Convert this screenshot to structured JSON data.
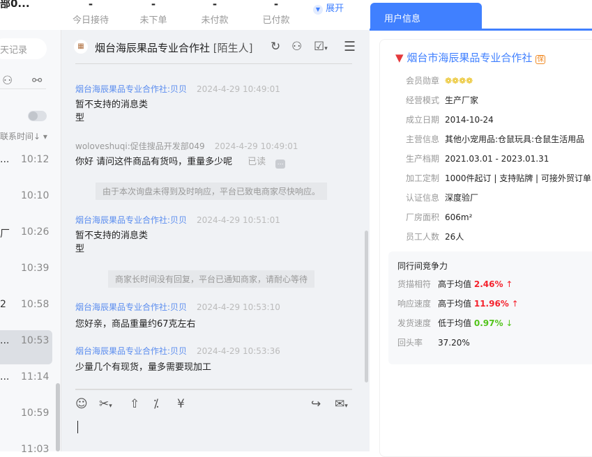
{
  "top": {
    "truncated_title": "部0...",
    "stats": [
      {
        "value": "-",
        "label": "今日接待"
      },
      {
        "value": "-",
        "label": "未下单"
      },
      {
        "value": "-",
        "label": "未付款"
      },
      {
        "value": "-",
        "label": "已付款"
      }
    ],
    "expand_label": "展开"
  },
  "left": {
    "search_placeholder": "天记录",
    "sort_label": "联系时间↓",
    "items": [
      {
        "prefix": "...",
        "time": "10:12"
      },
      {
        "prefix": "",
        "time": "10:10"
      },
      {
        "prefix": "厂",
        "time": "10:26"
      },
      {
        "prefix": "",
        "time": "10:39"
      },
      {
        "prefix": "2",
        "time": "10:58"
      },
      {
        "prefix": "...",
        "time": "10:53",
        "selected": true
      },
      {
        "prefix": "...",
        "time": "11:14"
      },
      {
        "prefix": "",
        "time": "10:59"
      },
      {
        "prefix": "",
        "time": "11:03"
      }
    ]
  },
  "chat": {
    "title": "烟台海辰果品专业合作社",
    "tag": "[陌生人]",
    "messages": [
      {
        "sender": "烟台海辰果品专业合作社:贝贝",
        "time": "2024-4-29 10:49:01",
        "text1": "暂不支持的消息类",
        "text2": "型"
      },
      {
        "sender": "woloveshuqi:促佳搜品开发部049",
        "time": "2024-4-29 10:49:01",
        "text": "你好 请问这件商品有货吗，重量多少呢",
        "status": "已读"
      },
      {
        "system": "由于本次询盘未得到及时响应，平台已致电商家尽快响应。"
      },
      {
        "sender": "烟台海辰果品专业合作社:贝贝",
        "time": "2024-4-29 10:51:01",
        "text1": "暂不支持的消息类",
        "text2": "型"
      },
      {
        "system": "商家长时间没有回复，平台已通知商家，请耐心等待"
      },
      {
        "sender": "烟台海辰果品专业合作社:贝贝",
        "time": "2024-4-29 10:53:10",
        "text": "您好亲，商品重量约67克左右"
      },
      {
        "sender": "烟台海辰果品专业合作社:贝贝",
        "time": "2024-4-29 10:53:36",
        "text": "少量几个有现货，量多需要现加工"
      }
    ]
  },
  "right": {
    "tab": "用户信息",
    "company": "烟台市海辰果品专业合作社",
    "badge": "保",
    "fields": [
      {
        "k": "会员勋章",
        "v": ""
      },
      {
        "k": "经营模式",
        "v": "生产厂家"
      },
      {
        "k": "成立日期",
        "v": "2014-10-24"
      },
      {
        "k": "主营信息",
        "v": "其他小宠用品:仓鼠玩具:仓鼠生活用品"
      },
      {
        "k": "生产档期",
        "v": "2021.03.01 - 2023.01.31"
      },
      {
        "k": "加工定制",
        "v": "1000件起订 | 支持贴牌 | 可接外贸订单"
      },
      {
        "k": "认证信息",
        "v": "深度验厂"
      },
      {
        "k": "厂房面积",
        "v": "606m²"
      },
      {
        "k": "员工人数",
        "v": "26人"
      }
    ],
    "medal_count": 4,
    "competition": {
      "title": "同行间竞争力",
      "rows": [
        {
          "k": "货描相符",
          "v": "高于均值",
          "pct": "2.46%",
          "arrow": "↑",
          "color": "#f5222d"
        },
        {
          "k": "响应速度",
          "v": "高于均值",
          "pct": "11.96%",
          "arrow": "↑",
          "color": "#f5222d"
        },
        {
          "k": "发货速度",
          "v": "低于均值",
          "pct": "0.97%",
          "arrow": "↓",
          "color": "#52c41a"
        },
        {
          "k": "回头率",
          "v": "37.20%",
          "pct": "",
          "arrow": "",
          "color": "#333"
        }
      ]
    }
  },
  "colors": {
    "accent": "#4080ff",
    "sender": "#5b8def"
  }
}
